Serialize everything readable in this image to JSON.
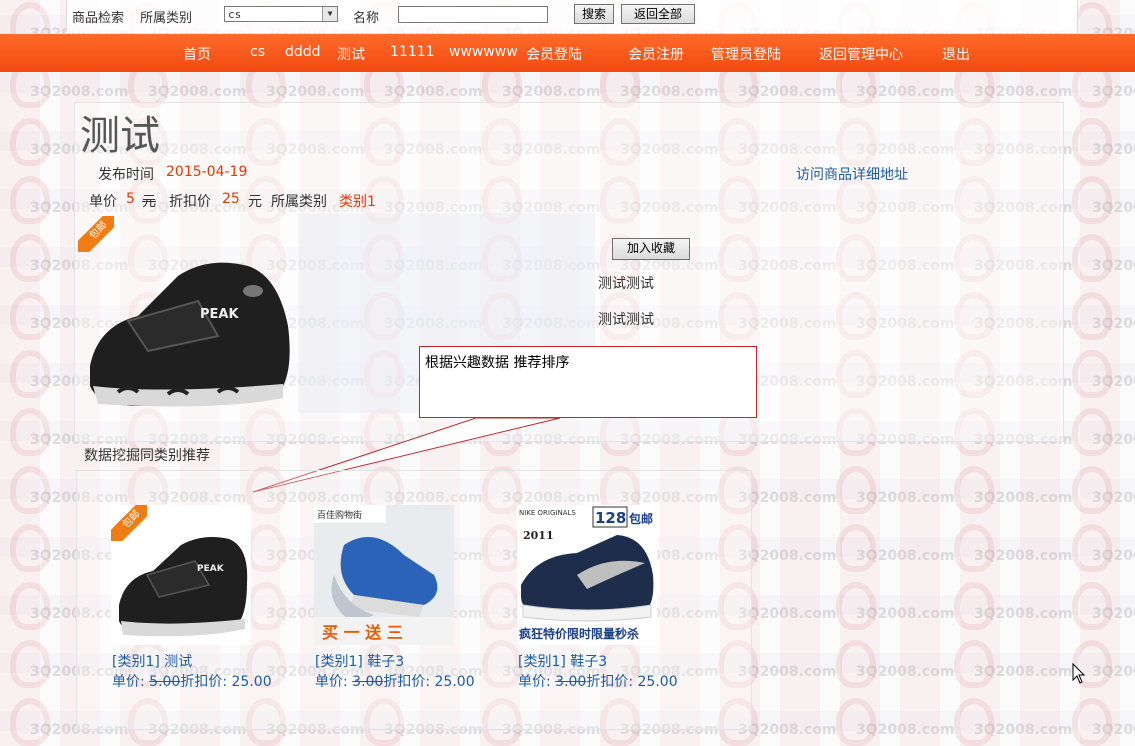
{
  "search": {
    "label": "商品检索",
    "category_label": "所属类别",
    "category_value": "cs",
    "name_label": "名称",
    "name_value": "",
    "search_button": "搜索",
    "reset_button": "返回全部"
  },
  "nav": {
    "items": [
      "首页",
      "cs",
      "dddd",
      "测试",
      "11111",
      "wwwwww",
      "会员登陆",
      "会员注册",
      "管理员登陆",
      "返回管理中心",
      "退出"
    ]
  },
  "product": {
    "title": "测试",
    "publish_label": "发布时间",
    "publish_date": "2015-04-19",
    "detail_link": "访问商品详细地址",
    "price_label": "单价",
    "price": "5",
    "price_unit": "元",
    "discount_label": "折扣价",
    "discount": "25",
    "discount_unit": "元",
    "category_label": "所属类别",
    "category": "类别1",
    "fav_button": "加入收藏",
    "desc_lines": [
      "测试测试",
      "测试测试"
    ],
    "badge_text": "包邮",
    "shoe_brand": "PEAK",
    "accent_color": "#e23a00"
  },
  "callout": {
    "text": "根据兴趣数据  推荐排序"
  },
  "recommend": {
    "heading": "数据挖掘同类别推荐",
    "items": [
      {
        "title": "[类别1] 测试",
        "price_label": "单价: ",
        "price": "5.00",
        "discount_label": "折扣价: ",
        "discount": "25.00"
      },
      {
        "title": "[类别1] 鞋子3",
        "price_label": "单价: ",
        "price": "3.00",
        "discount_label": "折扣价: ",
        "discount": "25.00"
      },
      {
        "title": "[类别1] 鞋子3",
        "price_label": "单价: ",
        "price": "3.00",
        "discount_label": "折扣价: ",
        "discount": "25.00"
      }
    ],
    "img2": {
      "top_text": "百佳购物街",
      "bottom_text": "买 一 送 三"
    },
    "img3": {
      "brand": "NIKE ORIGINALS",
      "year": "2011",
      "price_tag": "128",
      "free_ship": "包邮",
      "slogan": "疯狂特价限时限量秒杀"
    }
  },
  "watermark": "3Q2008.com",
  "colors": {
    "nav": "#f24a10",
    "link": "#1a5da6",
    "price": "#e23a00"
  }
}
